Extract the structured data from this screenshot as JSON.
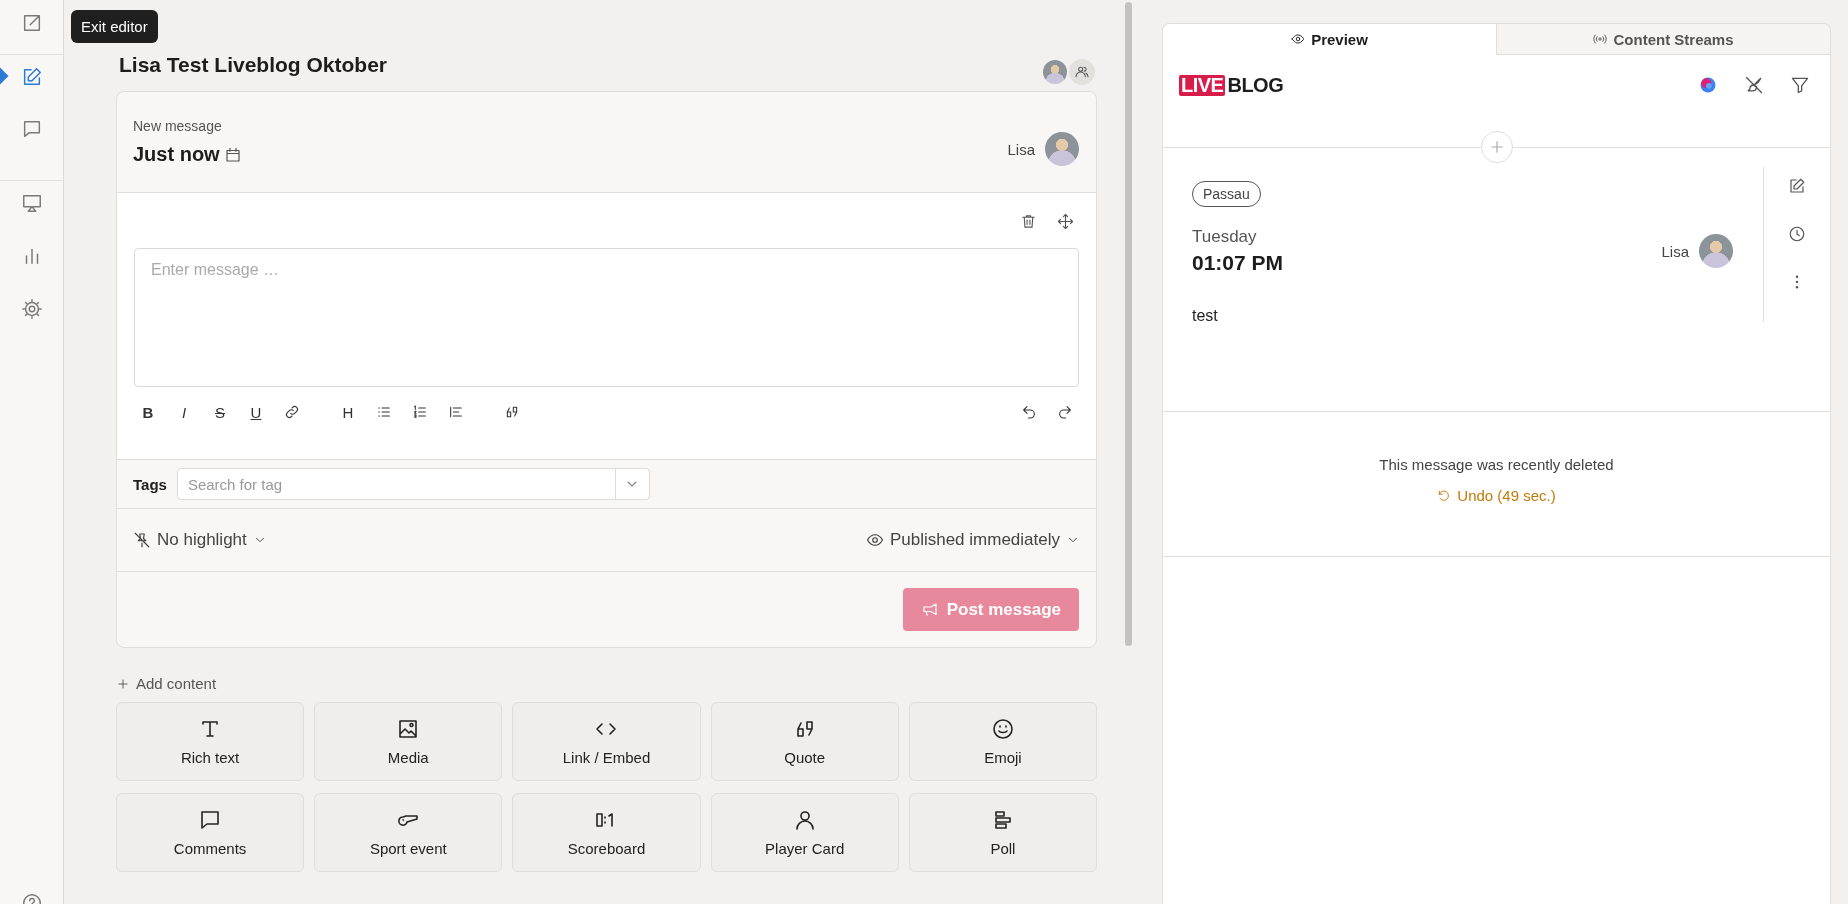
{
  "sidebar": {
    "items": [
      {
        "kind": "exit",
        "selected": false
      },
      {
        "kind": "edit",
        "selected": true
      },
      {
        "kind": "chat",
        "selected": false
      },
      {
        "kind": "screen",
        "selected": false
      },
      {
        "kind": "chart",
        "selected": false
      },
      {
        "kind": "settings",
        "selected": false
      }
    ],
    "help": {
      "kind": "help"
    },
    "tooltip": "Exit editor"
  },
  "editor": {
    "title": "Lisa Test Liveblog Oktober",
    "message": {
      "label": "New message",
      "time": "Just now",
      "author": "Lisa",
      "placeholder": "Enter message …",
      "toolbar": [
        {
          "kind": "text",
          "label": "B"
        },
        {
          "kind": "text",
          "label": "I"
        },
        {
          "kind": "text",
          "label": "S"
        },
        {
          "kind": "text",
          "label": "U"
        },
        {
          "kind": "link"
        },
        {
          "kind": "text",
          "label": "H"
        },
        {
          "kind": "bullets"
        },
        {
          "kind": "numbers"
        },
        {
          "kind": "indent"
        },
        {
          "kind": "quote"
        }
      ],
      "tags_label": "Tags",
      "tags_placeholder": "Search for tag",
      "highlight": "No highlight",
      "visibility": "Published immediately",
      "post_button": {
        "label": "Post message",
        "disabled": true
      }
    },
    "add_content": "Add content",
    "blocks": [
      {
        "kind": "text",
        "label": "Rich text"
      },
      {
        "kind": "media",
        "label": "Media"
      },
      {
        "kind": "code",
        "label": "Link / Embed"
      },
      {
        "kind": "quote",
        "label": "Quote"
      },
      {
        "kind": "emoji",
        "label": "Emoji"
      },
      {
        "kind": "chat",
        "label": "Comments"
      },
      {
        "kind": "whistle",
        "label": "Sport event"
      },
      {
        "kind": "score",
        "label": "Scoreboard"
      },
      {
        "kind": "user",
        "label": "Player Card"
      },
      {
        "kind": "poll",
        "label": "Poll"
      }
    ]
  },
  "preview": {
    "tabs": [
      {
        "label": "Preview",
        "kind": "eye",
        "selected": true
      },
      {
        "label": "Content Streams",
        "kind": "broadcast",
        "selected": false
      }
    ],
    "logo": {
      "live": "LIVE",
      "blog": "BLOG"
    },
    "post": {
      "tag": "Passau",
      "day": "Tuesday",
      "time": "01:07 PM",
      "author": "Lisa",
      "body": "test"
    },
    "deleted": {
      "message": "This message was recently deleted",
      "undo": "Undo (49 sec.)"
    }
  }
}
